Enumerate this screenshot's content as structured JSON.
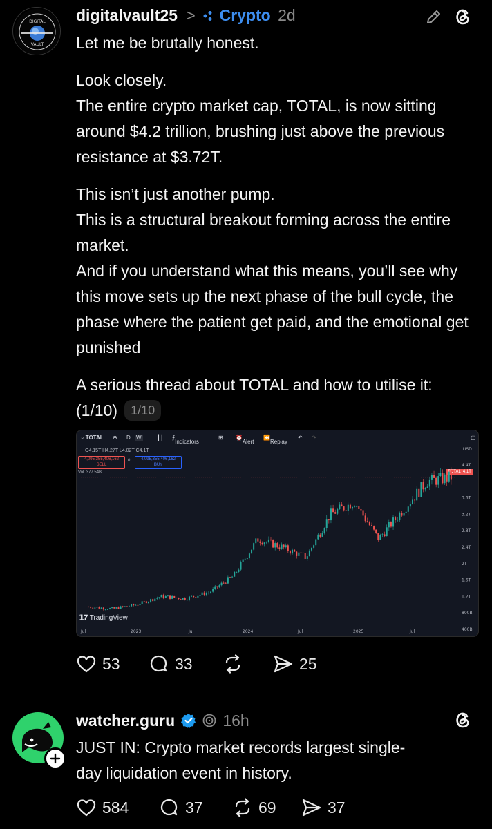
{
  "post1": {
    "username": "digitalvault25",
    "separator": ">",
    "community": "Crypto",
    "time": "2d",
    "avatar_text_top": "DIGITAL",
    "avatar_text_bottom": "VAULT",
    "paragraphs": [
      [
        "Let me be brutally honest."
      ],
      [
        "Look closely.",
        "The entire crypto market cap, TOTAL, is now sitting around $4.2 trillion, brushing just above the previous resistance at $3.72T."
      ],
      [
        "This isn’t just another pump.",
        "This is a structural breakout forming across the entire market.",
        "And if you understand what this means, you’ll see why this move sets up the next phase of the bull cycle, the phase where the patient get paid, and the emotional get punished"
      ],
      [
        "A serious thread about TOTAL and how to utilise it: (1/10)"
      ]
    ],
    "thread_counter": "1/10",
    "stats": {
      "likes": "53",
      "replies": "33",
      "shares": "25"
    }
  },
  "chart_toolbar": {
    "symbol": "TOTAL",
    "interval_d": "D",
    "interval_w": "W",
    "indicators": "Indicators",
    "alert": "Alert",
    "replay": "Replay",
    "ohlc": "O4.15T H4.27T L4.02T C4.1T",
    "sell_price": "4,095,355,406,162",
    "sell_label": "SELL",
    "spread": "0",
    "buy_price": "4,095,355,406,162",
    "buy_label": "BUY",
    "volume": "Vol  377.54B",
    "currency": "USD",
    "price_tag": "TOTAL  4.1T",
    "brand": "TradingView"
  },
  "chart_data": {
    "type": "candlestick",
    "title": "TOTAL",
    "x_tick_labels": [
      "Jul",
      "2023",
      "Jul",
      "2024",
      "Jul",
      "2025",
      "Jul"
    ],
    "y_tick_labels": [
      "4.4T",
      "3.6T",
      "3.2T",
      "2.8T",
      "2.4T",
      "2T",
      "1.6T",
      "1.2T",
      "800B",
      "400B"
    ],
    "y_unit": "USD",
    "current_value": "4.1T",
    "approx_series": [
      {
        "period": "2022-07",
        "close": 0.95
      },
      {
        "period": "2022-10",
        "close": 0.9
      },
      {
        "period": "2023-01",
        "close": 1.0
      },
      {
        "period": "2023-04",
        "close": 1.2
      },
      {
        "period": "2023-07",
        "close": 1.15
      },
      {
        "period": "2023-10",
        "close": 1.3
      },
      {
        "period": "2024-01",
        "close": 1.7
      },
      {
        "period": "2024-03",
        "close": 2.6
      },
      {
        "period": "2024-06",
        "close": 2.4
      },
      {
        "period": "2024-09",
        "close": 2.15
      },
      {
        "period": "2024-11",
        "close": 3.2
      },
      {
        "period": "2025-01",
        "close": 3.5
      },
      {
        "period": "2025-04",
        "close": 2.6
      },
      {
        "period": "2025-06",
        "close": 3.3
      },
      {
        "period": "2025-08",
        "close": 4.0
      },
      {
        "period": "2025-10",
        "close": 4.1
      }
    ]
  },
  "post2": {
    "username": "watcher.guru",
    "time": "16h",
    "body": [
      "JUST IN: Crypto market records largest single-",
      "day liquidation event in history."
    ],
    "stats": {
      "likes": "584",
      "replies": "37",
      "reposts": "69",
      "shares": "37"
    }
  },
  "colors": {
    "background": "#000000",
    "verified": "#1d9bf0",
    "community": "#3d8ef0",
    "watcher_green": "#2fd26c",
    "candle_up": "#26a69a",
    "candle_down": "#ef5350"
  }
}
